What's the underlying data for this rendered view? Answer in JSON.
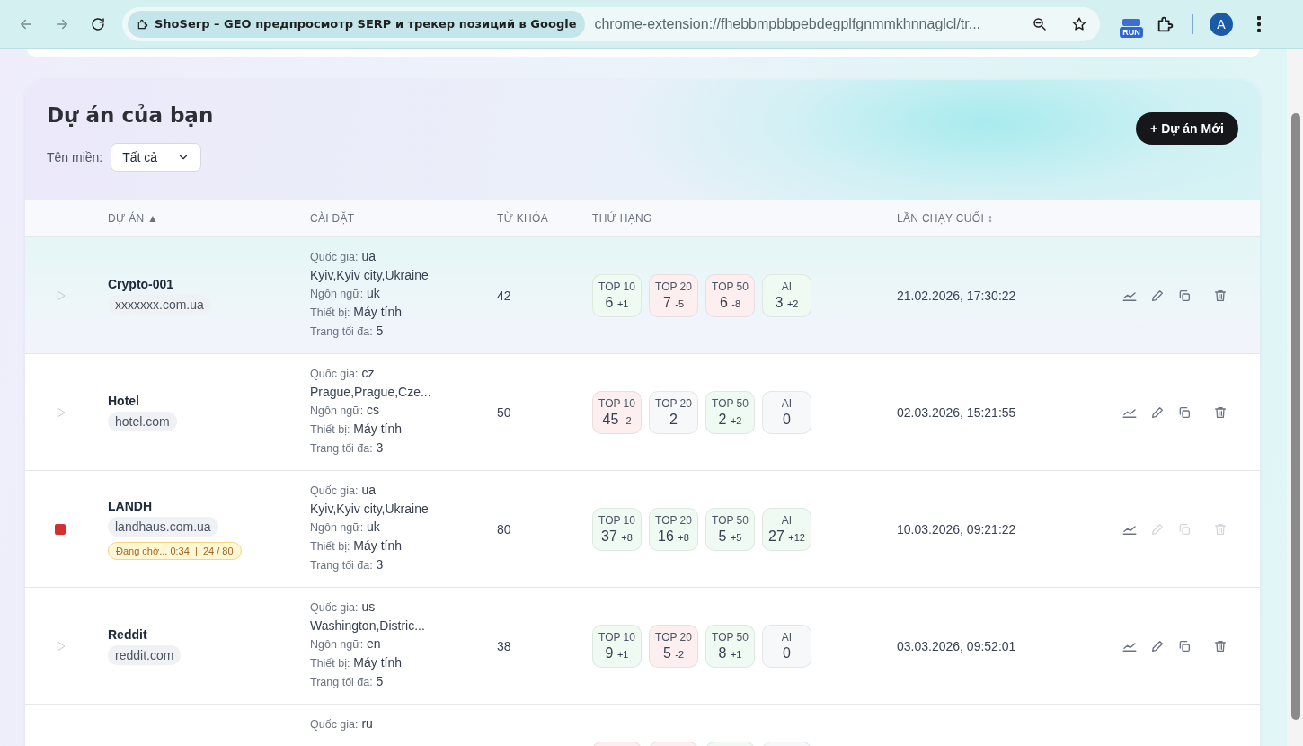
{
  "browser": {
    "tab_title": "ShoSerp – GEO предпросмотр SERP и трекер позиций в Google",
    "url": "chrome-extension://fhebbmpbbpebdegplfgnmmkhnnaglcl/tr...",
    "extension_label": "RUN",
    "avatar": "A"
  },
  "page": {
    "title": "Dự án của bạn",
    "new_button": "+ Dự án Mới",
    "filter": {
      "label": "Tên miền:",
      "value": "Tất cả"
    }
  },
  "table": {
    "columns": [
      "DỰ ÁN ▲",
      "CÀI ĐẶT",
      "TỪ KHÓA",
      "THỨ HẠNG",
      "LẦN CHẠY CUỐI ↕"
    ],
    "rows": [
      {
        "selected": true,
        "running": false,
        "name": "Crypto-001",
        "domain": "xxxxxxx.com.ua",
        "settings": [
          {
            "label": "Quốc gia:",
            "value": "ua"
          },
          {
            "value": "Kyiv,Kyiv city,Ukraine"
          },
          {
            "label": "Ngôn ngữ:",
            "value": "uk"
          },
          {
            "label": "Thiết bị:",
            "value": "Máy tính"
          },
          {
            "label": "Trang tối đa:",
            "value": "5"
          }
        ],
        "keywords": "42",
        "ranks": [
          {
            "label": "TOP 10",
            "value": "6",
            "delta": "+1",
            "color": "#effaf2"
          },
          {
            "label": "TOP 20",
            "value": "7",
            "delta": "-5",
            "color": "#fdefef"
          },
          {
            "label": "TOP 50",
            "value": "6",
            "delta": "-8",
            "color": "#fdefef"
          },
          {
            "label": "AI",
            "value": "3",
            "delta": "+2",
            "color": "#effaf2"
          }
        ],
        "last_run": "21.02.2026, 17:30:22"
      },
      {
        "selected": false,
        "running": false,
        "name": "Hotel",
        "domain": "hotel.com",
        "settings": [
          {
            "label": "Quốc gia:",
            "value": "cz"
          },
          {
            "value": "Prague,Prague,Cze..."
          },
          {
            "label": "Ngôn ngữ:",
            "value": "cs"
          },
          {
            "label": "Thiết bị:",
            "value": "Máy tính"
          },
          {
            "label": "Trang tối đa:",
            "value": "3"
          }
        ],
        "keywords": "50",
        "ranks": [
          {
            "label": "TOP 10",
            "value": "45",
            "delta": "-2",
            "color": "#fdefef"
          },
          {
            "label": "TOP 20",
            "value": "2",
            "color": "#f7f8f9"
          },
          {
            "label": "TOP 50",
            "value": "2",
            "delta": "+2",
            "color": "#effaf2"
          },
          {
            "label": "AI",
            "value": "0",
            "color": "#f7f8f9"
          }
        ],
        "last_run": "02.03.2026, 15:21:55"
      },
      {
        "selected": false,
        "running": true,
        "name": "LANDH",
        "domain": "landhaus.com.ua",
        "status": "Đang chờ... 0:34  |  24 / 80",
        "settings": [
          {
            "label": "Quốc gia:",
            "value": "ua"
          },
          {
            "value": "Kyiv,Kyiv city,Ukraine"
          },
          {
            "label": "Ngôn ngữ:",
            "value": "uk"
          },
          {
            "label": "Thiết bị:",
            "value": "Máy tính"
          },
          {
            "label": "Trang tối đa:",
            "value": "3"
          }
        ],
        "keywords": "80",
        "ranks": [
          {
            "label": "TOP 10",
            "value": "37",
            "delta": "+8",
            "color": "#effaf2"
          },
          {
            "label": "TOP 20",
            "value": "16",
            "delta": "+8",
            "color": "#effaf2"
          },
          {
            "label": "TOP 50",
            "value": "5",
            "delta": "+5",
            "color": "#effaf2"
          },
          {
            "label": "AI",
            "value": "27",
            "delta": "+12",
            "color": "#effaf2"
          }
        ],
        "last_run": "10.03.2026, 09:21:22"
      },
      {
        "selected": false,
        "running": false,
        "name": "Reddit",
        "domain": "reddit.com",
        "settings": [
          {
            "label": "Quốc gia:",
            "value": "us"
          },
          {
            "value": "Washington,Distric..."
          },
          {
            "label": "Ngôn ngữ:",
            "value": "en"
          },
          {
            "label": "Thiết bị:",
            "value": "Máy tính"
          },
          {
            "label": "Trang tối đa:",
            "value": "5"
          }
        ],
        "keywords": "38",
        "ranks": [
          {
            "label": "TOP 10",
            "value": "9",
            "delta": "+1",
            "color": "#effaf2"
          },
          {
            "label": "TOP 20",
            "value": "5",
            "delta": "-2",
            "color": "#fdefef"
          },
          {
            "label": "TOP 50",
            "value": "8",
            "delta": "+1",
            "color": "#effaf2"
          },
          {
            "label": "AI",
            "value": "0",
            "color": "#f7f8f9"
          }
        ],
        "last_run": "03.03.2026, 09:52:01"
      },
      {
        "selected": false,
        "settings": [
          {
            "label": "Quốc gia:",
            "value": "ru"
          }
        ],
        "ranks": [
          {
            "color": "#fdefef"
          },
          {
            "color": "#fdefef"
          },
          {
            "color": "#effaf2"
          },
          {
            "color": "#f7f8f9"
          }
        ]
      }
    ]
  }
}
